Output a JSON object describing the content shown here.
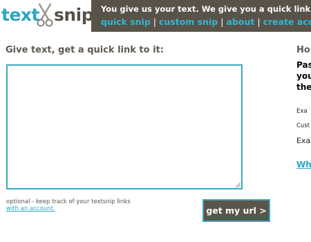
{
  "logo": {
    "part1": "text",
    "part2": "snip"
  },
  "header": {
    "tagline": "You give us your text.  We give you a quick link pointing to it.",
    "nav": [
      {
        "label": "quick snip"
      },
      {
        "label": "custom snip"
      },
      {
        "label": "about"
      },
      {
        "label": "create account"
      }
    ],
    "separator": "|"
  },
  "main": {
    "prompt": "Give text, get a quick link to it:",
    "textarea_value": "",
    "optional_text": "optional - keep track of your textsnip links",
    "optional_link": "with an account.",
    "submit_label": "get my url >"
  },
  "right": {
    "heading": "Ho",
    "bold_lines": [
      "Pas",
      "you",
      "the"
    ],
    "small1": "Exa",
    "small2": "Cust",
    "medium": "Exa",
    "link": "Wh"
  },
  "colors": {
    "accent": "#2ba6c4",
    "dark": "#585248",
    "text": "#5e5850"
  }
}
